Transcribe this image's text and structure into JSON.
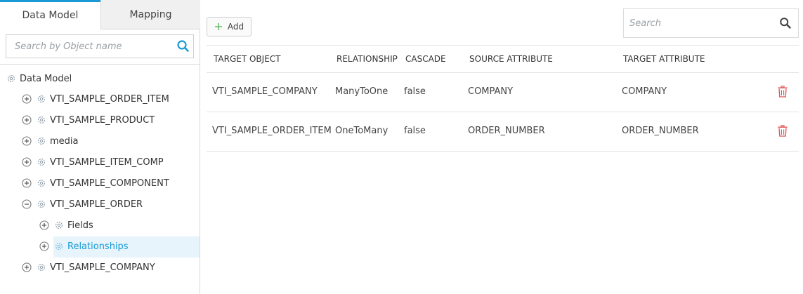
{
  "left_panel": {
    "tabs": [
      {
        "label": "Data Model",
        "active": true
      },
      {
        "label": "Mapping",
        "active": false
      }
    ],
    "search": {
      "placeholder": "Search by Object name",
      "value": ""
    },
    "tree": {
      "root": {
        "label": "Data Model"
      },
      "items": [
        {
          "label": "VTI_SAMPLE_ORDER_ITEM",
          "expanded": false
        },
        {
          "label": "VTI_SAMPLE_PRODUCT",
          "expanded": false
        },
        {
          "label": "media",
          "expanded": false
        },
        {
          "label": "VTI_SAMPLE_ITEM_COMP",
          "expanded": false
        },
        {
          "label": "VTI_SAMPLE_COMPONENT",
          "expanded": false
        },
        {
          "label": "VTI_SAMPLE_ORDER",
          "expanded": true,
          "children": [
            {
              "label": "Fields",
              "expanded": false
            },
            {
              "label": "Relationships",
              "expanded": false,
              "selected": true
            }
          ]
        },
        {
          "label": "VTI_SAMPLE_COMPANY",
          "expanded": false
        }
      ]
    }
  },
  "toolbar": {
    "add_label": "Add",
    "search": {
      "placeholder": "Search",
      "value": ""
    }
  },
  "table": {
    "columns": [
      "TARGET OBJECT",
      "RELATIONSHIP",
      "CASCADE",
      "SOURCE ATTRIBUTE",
      "TARGET ATTRIBUTE"
    ],
    "rows": [
      [
        "VTI_SAMPLE_COMPANY",
        "ManyToOne",
        "false",
        "COMPANY",
        "COMPANY"
      ],
      [
        "VTI_SAMPLE_ORDER_ITEM",
        "OneToMany",
        "false",
        "ORDER_NUMBER",
        "ORDER_NUMBER"
      ]
    ]
  },
  "icons": {
    "search": "search-icon",
    "add": "plus-icon",
    "expand": "plus-circle-icon",
    "collapse": "minus-circle-icon",
    "node": "gear-icon",
    "delete": "trash-icon"
  },
  "colors": {
    "accent": "#1a9bd7",
    "selected_bg": "#e8f4fb",
    "delete": "#e05252",
    "add_plus": "#5cb85c"
  }
}
